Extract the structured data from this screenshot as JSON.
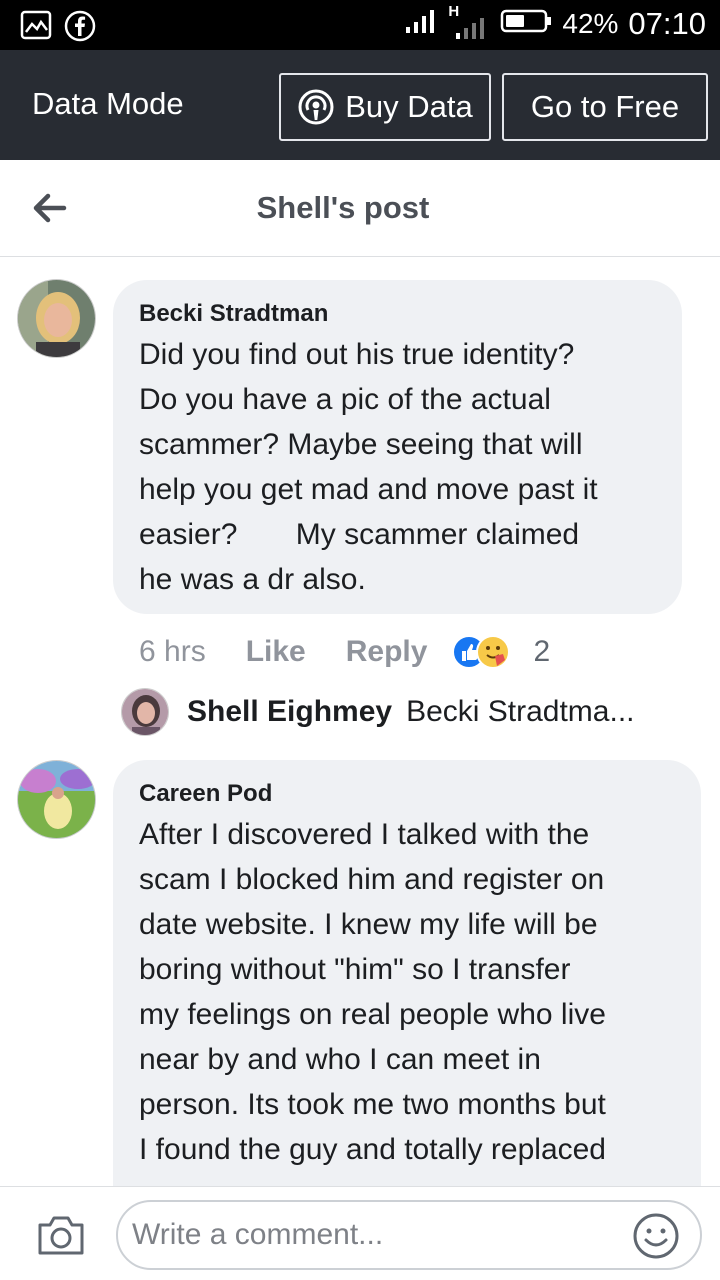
{
  "status_bar": {
    "network": "H",
    "battery": "42%",
    "time": "07:10",
    "icons": [
      "gallery-icon",
      "facebook-icon",
      "signal-icon",
      "battery-icon"
    ]
  },
  "data_bar": {
    "title": "Data Mode",
    "buy_label": "Buy Data",
    "free_label": "Go to Free"
  },
  "header": {
    "title": "Shell's post"
  },
  "comments": [
    {
      "author": "Becki Stradtman",
      "text": "Did you find out his true identity?\nDo you have a pic of the actual\nscammer? Maybe seeing that will\nhelp you get mad and move past it\neasier?       My scammer claimed\nhe was a dr also.",
      "time": "6 hrs",
      "like_label": "Like",
      "reply_label": "Reply",
      "reaction_count": "2",
      "reply": {
        "author": "Shell Eighmey",
        "preview": "Becki Stradtma..."
      }
    },
    {
      "author": "Careen Pod",
      "text": "After I discovered I talked with the\nscam I blocked him and register on\ndate website. I knew my life will be\nboring without \"him\" so I transfer\nmy feelings on real people who live\nnear by and who I can meet in\nperson. Its took me two months but\nI found the guy and totally replaced"
    }
  ],
  "composer": {
    "placeholder": "Write a comment..."
  },
  "colors": {
    "data_bar_bg": "#282c33",
    "bubble_bg": "#eff1f4",
    "like_blue": "#1877f2"
  }
}
